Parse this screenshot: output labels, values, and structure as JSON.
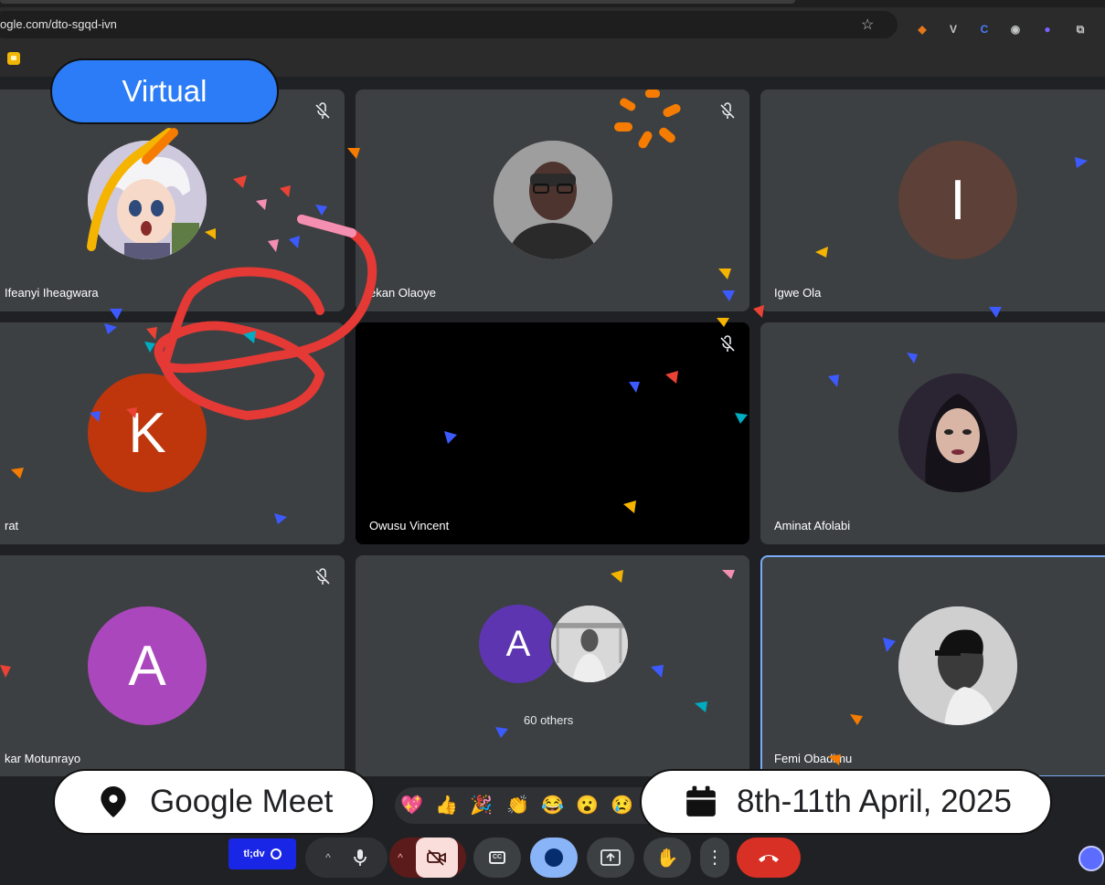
{
  "browser": {
    "url": "ogle.com/dto-sgqd-ivn",
    "star_icon": "star-icon",
    "extensions": [
      "metamask-icon",
      "v-icon",
      "c-icon",
      "circle-icon",
      "purple-icon",
      "puzzle-icon"
    ]
  },
  "meet": {
    "participants": [
      {
        "name": "Ifeanyi Iheagwara",
        "muted": true,
        "avatar": "anime-photo"
      },
      {
        "name": "ekan Olaoye",
        "muted": true,
        "avatar": "photo"
      },
      {
        "name": "Igwe Ola",
        "muted": false,
        "avatar_letter": "I",
        "color": "#5d4037"
      },
      {
        "name": "rat",
        "muted": false,
        "avatar_letter": "K",
        "color": "#bf360c"
      },
      {
        "name": "Owusu Vincent",
        "muted": true,
        "avatar": "none"
      },
      {
        "name": "Aminat Afolabi",
        "muted": false,
        "avatar": "photo"
      },
      {
        "name": "kar Motunrayo",
        "muted": true,
        "avatar_letter": "A",
        "color": "#ab47bc"
      },
      {
        "name": "60 others",
        "muted": false,
        "avatar_letter": "A",
        "color": "#5e35b1"
      },
      {
        "name": "Femi Obadimu",
        "muted": false,
        "avatar": "photo",
        "active": true
      }
    ],
    "others_label": "60 others"
  },
  "overlays": {
    "virtual": "Virtual",
    "platform": "Google Meet",
    "dates": "8th-11th April, 2025"
  },
  "reactions": [
    "💖",
    "👍",
    "🎉",
    "👏",
    "😂",
    "😮",
    "😢"
  ],
  "controls": {
    "tldv": "tl;dv",
    "items": [
      "chevron-up-icon",
      "mic-icon",
      "chevron-up-icon",
      "camera-off-icon",
      "captions-icon",
      "emoji-icon",
      "present-icon",
      "raise-hand-icon",
      "more-icon",
      "end-call-icon"
    ]
  },
  "colors": {
    "accent": "#8ab4f8",
    "end_call": "#d93025",
    "virtual": "#2b7cf6"
  }
}
